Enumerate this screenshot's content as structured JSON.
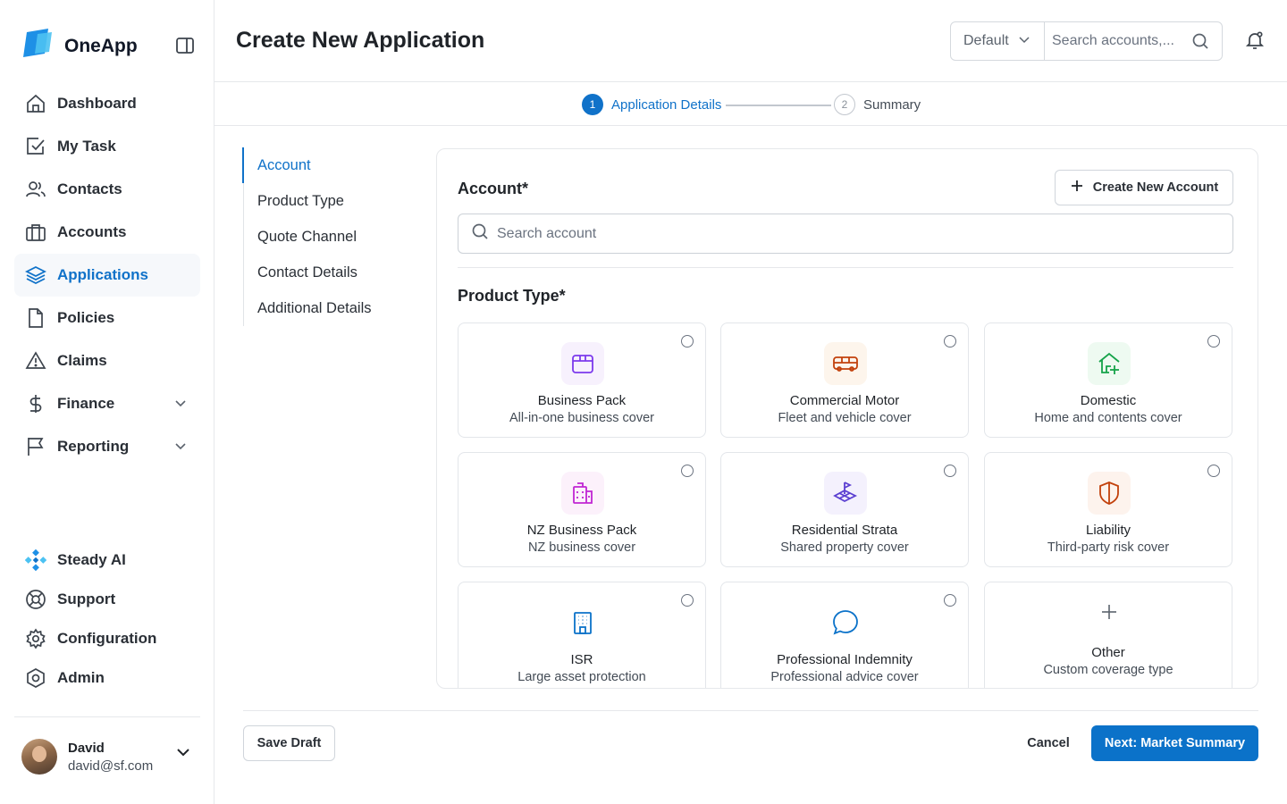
{
  "app": {
    "name": "OneApp"
  },
  "sidebar": {
    "items": [
      {
        "label": "Dashboard",
        "icon": "home-icon"
      },
      {
        "label": "My Task",
        "icon": "task-check-icon"
      },
      {
        "label": "Contacts",
        "icon": "users-icon"
      },
      {
        "label": "Accounts",
        "icon": "briefcase-icon"
      },
      {
        "label": "Applications",
        "icon": "layers-icon",
        "active": true
      },
      {
        "label": "Policies",
        "icon": "document-icon"
      },
      {
        "label": "Claims",
        "icon": "warning-icon"
      },
      {
        "label": "Finance",
        "icon": "dollar-icon",
        "expandable": true
      },
      {
        "label": "Reporting",
        "icon": "flag-icon",
        "expandable": true
      }
    ],
    "bottom_items": [
      {
        "label": "Steady AI",
        "icon": "ai-diamond-icon"
      },
      {
        "label": "Support",
        "icon": "lifebuoy-icon"
      },
      {
        "label": "Configuration",
        "icon": "gear-icon"
      },
      {
        "label": "Admin",
        "icon": "shield-hex-icon"
      }
    ],
    "user": {
      "name": "David",
      "email": "david@sf.com"
    }
  },
  "header": {
    "title": "Create New Application",
    "selector_value": "Default",
    "search_placeholder": "Search accounts,..."
  },
  "stepper": {
    "steps": [
      {
        "number": "1",
        "label": "Application Details",
        "state": "current"
      },
      {
        "number": "2",
        "label": "Summary",
        "state": "upcoming"
      }
    ]
  },
  "section_nav": [
    {
      "label": "Account",
      "active": true
    },
    {
      "label": "Product Type"
    },
    {
      "label": "Quote Channel"
    },
    {
      "label": "Contact Details"
    },
    {
      "label": "Additional Details"
    }
  ],
  "account": {
    "label": "Account*",
    "create_button": "Create New Account",
    "search_placeholder": "Search account"
  },
  "product_type": {
    "label": "Product Type*",
    "cards": [
      {
        "title": "Business Pack",
        "subtitle": "All-in-one business cover",
        "icon": "box-icon",
        "color": "#7c3aed",
        "bg": "#f7f1fd"
      },
      {
        "title": "Commercial Motor",
        "subtitle": "Fleet and vehicle cover",
        "icon": "bus-icon",
        "color": "#c2410c",
        "bg": "#fdf5ec"
      },
      {
        "title": "Domestic",
        "subtitle": "Home and contents cover",
        "icon": "house-plus-icon",
        "color": "#16a34a",
        "bg": "#eefaf1"
      },
      {
        "title": "NZ Business Pack",
        "subtitle": "NZ business cover",
        "icon": "building-icon",
        "color": "#c026d3",
        "bg": "#fcf1fb"
      },
      {
        "title": "Residential Strata",
        "subtitle": "Shared property cover",
        "icon": "flag-layers-icon",
        "color": "#5b3fd1",
        "bg": "#f4f1fd"
      },
      {
        "title": "Liability",
        "subtitle": "Third-party risk cover",
        "icon": "shield-half-icon",
        "color": "#c2410c",
        "bg": "#fdf3ed"
      },
      {
        "title": "ISR",
        "subtitle": "Large asset protection",
        "icon": "office-building-icon",
        "color": "#0b72c9",
        "bg": "#ffffff"
      },
      {
        "title": "Professional Indemnity",
        "subtitle": "Professional advice cover",
        "icon": "chat-bubble-icon",
        "color": "#0b72c9",
        "bg": "#ffffff"
      },
      {
        "title": "Other",
        "subtitle": "Custom coverage type",
        "icon": "plus-icon",
        "color": "#5b636d",
        "bg": "#ffffff"
      }
    ]
  },
  "footer": {
    "save_draft": "Save Draft",
    "cancel": "Cancel",
    "next": "Next: Market Summary"
  },
  "colors": {
    "accent": "#0b72c9",
    "border": "#e6e8eb"
  }
}
